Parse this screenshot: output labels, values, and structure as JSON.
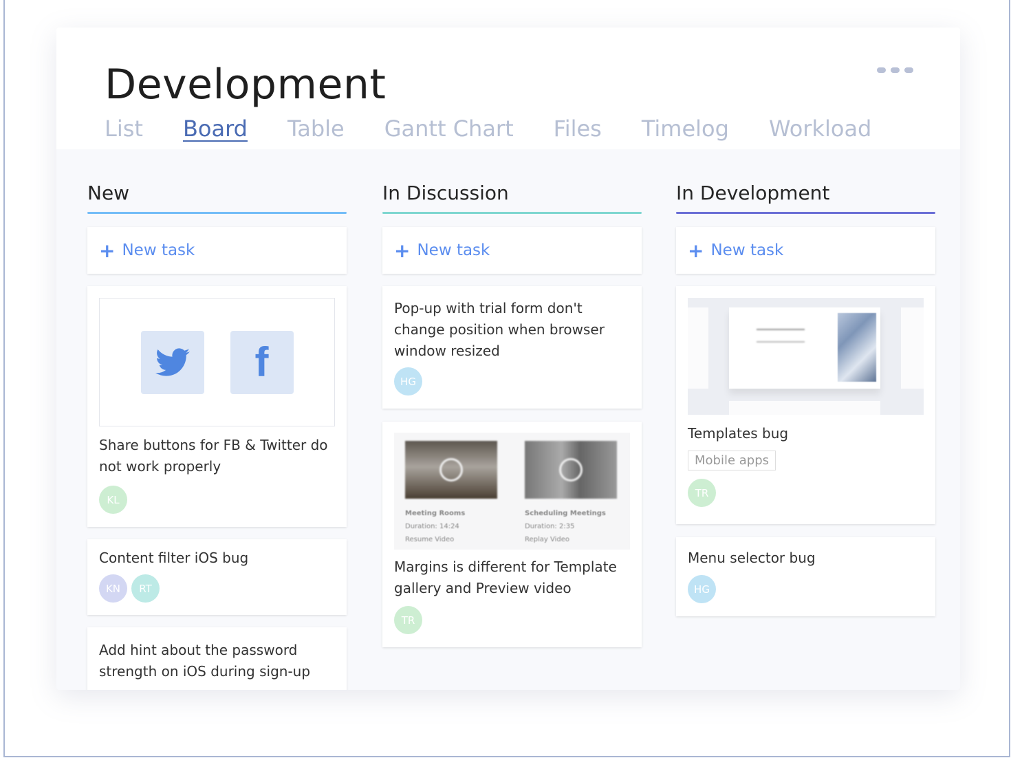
{
  "header": {
    "title": "Development",
    "tabs": [
      "List",
      "Board",
      "Table",
      "Gantt Chart",
      "Files",
      "Timelog",
      "Workload"
    ],
    "active_tab": "Board"
  },
  "colors": {
    "accent": "#5b8def",
    "new": "#74bdf7",
    "discussion": "#7ed6d0",
    "development": "#6a6fd6"
  },
  "columns": [
    {
      "title": "New",
      "new_task": "New task",
      "cards": [
        {
          "text": "Share buttons for FB & Twitter do not work properly",
          "avatars": [
            "KL"
          ],
          "icons": [
            "twitter-icon",
            "facebook-icon"
          ]
        },
        {
          "text": "Content filter iOS bug",
          "avatars": [
            "KN",
            "RT"
          ]
        },
        {
          "text": "Add hint about the password strength on iOS during sign-up"
        }
      ]
    },
    {
      "title": "In Discussion",
      "new_task": "New task",
      "cards": [
        {
          "text": "Pop-up with trial form don't change position when browser window resized",
          "avatars": [
            "HG"
          ]
        },
        {
          "text": "Margins is different for Template gallery and Preview video",
          "avatars": [
            "TR"
          ],
          "videos": [
            {
              "title": "Meeting Rooms",
              "duration": "Duration: 14:24",
              "action": "Resume Video"
            },
            {
              "title": "Scheduling Meetings",
              "duration": "Duration: 2:35",
              "action": "Replay Video"
            }
          ]
        }
      ]
    },
    {
      "title": "In Development",
      "new_task": "New task",
      "cards": [
        {
          "text": "Templates bug",
          "tag": "Mobile apps",
          "avatars": [
            "TR"
          ]
        },
        {
          "text": "Menu selector bug",
          "avatars": [
            "HG"
          ]
        }
      ]
    }
  ]
}
